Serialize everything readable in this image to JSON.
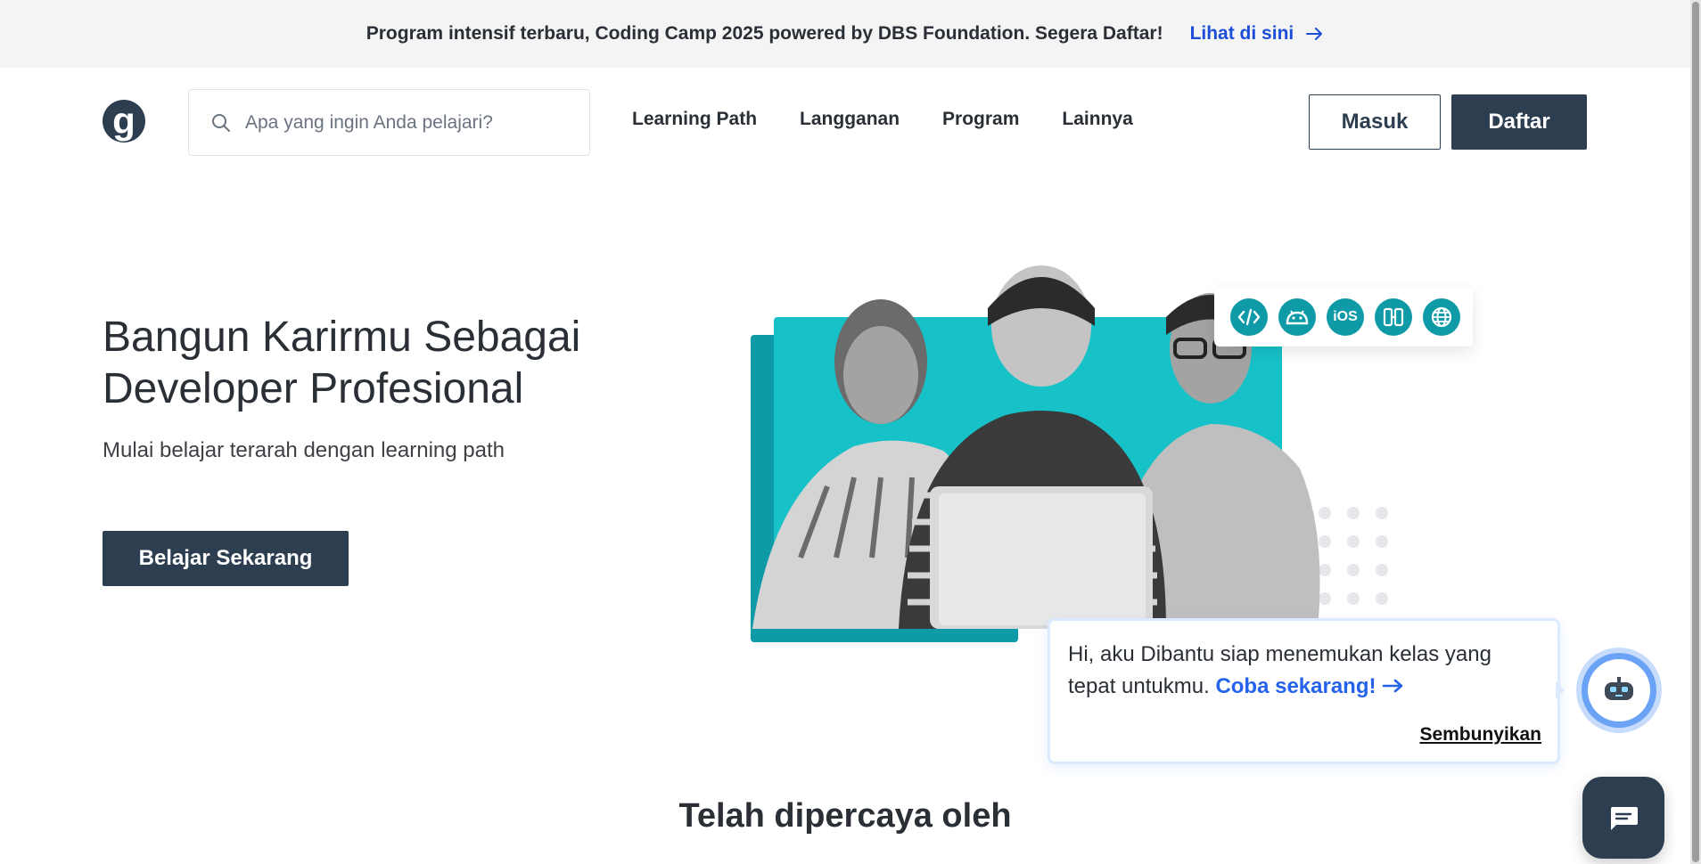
{
  "promo": {
    "text": "Program intensif terbaru, Coding Camp 2025 powered by DBS Foundation. Segera Daftar!",
    "link_label": "Lihat di sini",
    "link_icon": "arrow-right-icon"
  },
  "header": {
    "logo_text": "g",
    "search": {
      "placeholder": "Apa yang ingin Anda pelajari?",
      "value": ""
    },
    "nav": [
      {
        "label": "Learning Path"
      },
      {
        "label": "Langganan"
      },
      {
        "label": "Program"
      },
      {
        "label": "Lainnya"
      }
    ],
    "login_label": "Masuk",
    "register_label": "Daftar"
  },
  "hero": {
    "title": "Bangun Karirmu Sebagai Developer Profesional",
    "subtitle": "Mulai belajar terarah dengan learning path",
    "cta_label": "Belajar Sekarang",
    "tech_icons": [
      {
        "name": "code-icon",
        "glyph": "</>"
      },
      {
        "name": "android-icon",
        "glyph": ""
      },
      {
        "name": "ios-icon",
        "glyph": "iOS"
      },
      {
        "name": "multiplatform-icon",
        "glyph": ""
      },
      {
        "name": "web-icon",
        "glyph": ""
      }
    ]
  },
  "chat": {
    "message": "Hi, aku Dibantu siap menemukan kelas yang tepat untukmu.",
    "cta_label": "Coba sekarang!",
    "hide_label": "Sembunyikan"
  },
  "trusted": {
    "heading": "Telah dipercaya oleh"
  },
  "colors": {
    "primary": "#2d3e50",
    "accent_teal": "#16c2c8",
    "link_blue": "#2563eb"
  }
}
